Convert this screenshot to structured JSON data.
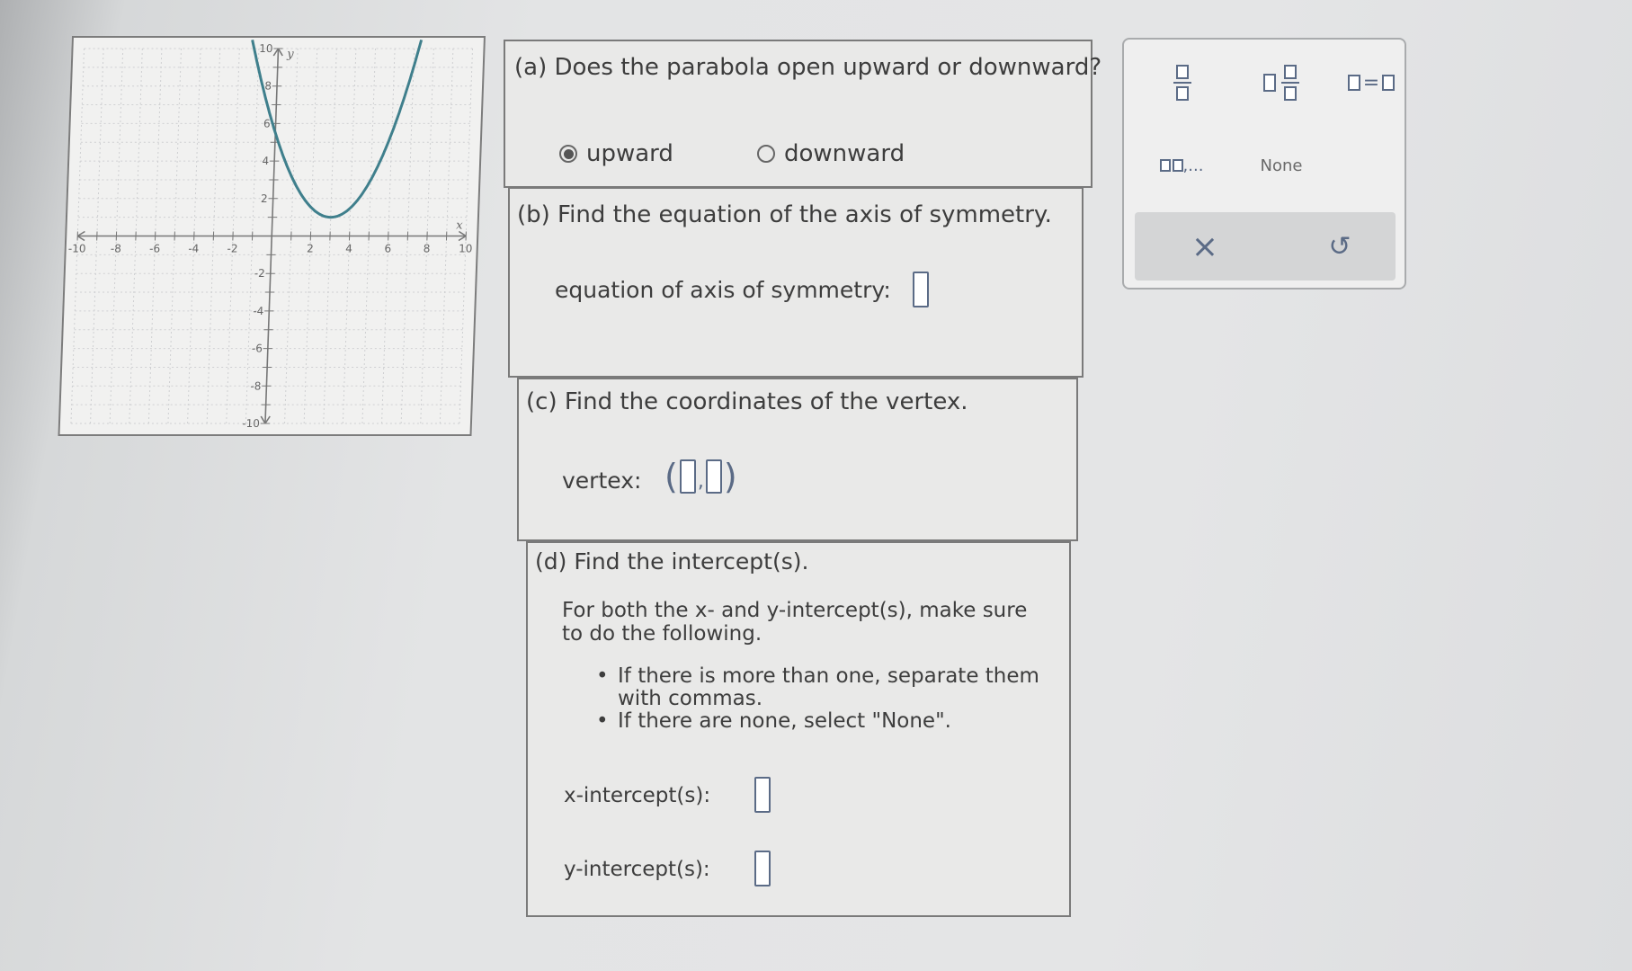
{
  "graph": {
    "x_axis_label": "x",
    "y_axis_label": "y",
    "x_ticks": [
      "-10",
      "-8",
      "-6",
      "-4",
      "-2",
      "2",
      "4",
      "6",
      "8",
      "10"
    ],
    "y_ticks": [
      "10",
      "8",
      "6",
      "4",
      "2",
      "-2",
      "-4",
      "-6",
      "-8",
      "-10"
    ],
    "xlim": [
      -10,
      10
    ],
    "ylim": [
      -10,
      10
    ],
    "curve": {
      "type": "parabola",
      "vertex": [
        3,
        1
      ],
      "a": 0.5,
      "color": "#3f7f8c"
    }
  },
  "part_a": {
    "prompt": "(a) Does the parabola open upward or downward?",
    "options": [
      {
        "label": "upward",
        "selected": true
      },
      {
        "label": "downward",
        "selected": false
      }
    ]
  },
  "part_b": {
    "prompt": "(b) Find the equation of the axis of symmetry.",
    "field_label": "equation of axis of symmetry:"
  },
  "part_c": {
    "prompt": "(c) Find the coordinates of the vertex.",
    "field_label": "vertex:",
    "open_paren": "(",
    "comma": ",",
    "close_paren": ")"
  },
  "part_d": {
    "prompt": "(d) Find the intercept(s).",
    "instructions_line1": "For both the x- and y-intercept(s), make sure",
    "instructions_line2": "to do the following.",
    "bullet1_line1": "If there is more than one, separate them",
    "bullet1_line2": "with commas.",
    "bullet2": "If there are none, select \"None\".",
    "x_intercept_label": "x-intercept(s):",
    "y_intercept_label": "y-intercept(s):"
  },
  "toolbar": {
    "list_button_ellipsis": ",...",
    "none_label": "None",
    "equals_sign": "=",
    "clear_icon": "×",
    "undo_icon": "↺",
    "accent_color": "#5b6b86"
  }
}
